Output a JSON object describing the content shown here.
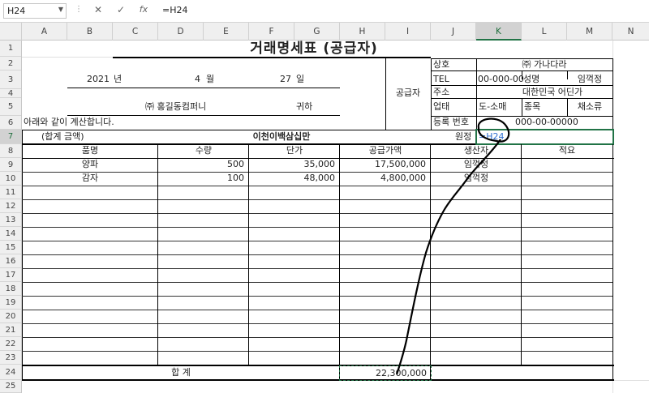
{
  "formula_bar": {
    "name_box": "H24",
    "cancel_icon": "cancel-icon",
    "enter_icon": "check-icon",
    "fx_label": "fx",
    "formula": "=H24"
  },
  "columns": [
    "A",
    "B",
    "C",
    "D",
    "E",
    "F",
    "G",
    "H",
    "I",
    "J",
    "K",
    "L",
    "M",
    "N"
  ],
  "selected_column": "K",
  "rows": [
    "1",
    "2",
    "3",
    "4",
    "5",
    "6",
    "7",
    "8",
    "9",
    "10",
    "11",
    "12",
    "13",
    "14",
    "15",
    "16",
    "17",
    "18",
    "19",
    "20",
    "21",
    "22",
    "23",
    "24",
    "25"
  ],
  "selected_row": "7",
  "invoice": {
    "title": "거래명세표 (공급자)",
    "year": "2021",
    "year_unit": "년",
    "month": "4",
    "month_unit": "월",
    "day": "27",
    "day_unit": "일",
    "recipient": "㈜ 홍길동컴퍼니",
    "honorific": "귀하",
    "statement": "아래와 같이 계산합니다.",
    "total_label": "(합계 금액)",
    "total_words": "이천이백삼십만",
    "won_label": "원정",
    "won_formula": "=H24",
    "supplier_label": "공급자",
    "supplier": {
      "company_label": "상호",
      "company": "㈜ 가나다라",
      "tel_label": "TEL",
      "tel": "00-000-00",
      "name_label": "성명",
      "name": "임꺽정",
      "address_label": "주소",
      "address": "대한민국 어딘가",
      "business_label": "업태",
      "business": "도-소매",
      "category_label": "종목",
      "category": "채소류",
      "reg_label": "등록 번호",
      "reg": "000-00-00000"
    },
    "table_headers": [
      "품명",
      "수량",
      "단가",
      "공급가액",
      "생산자",
      "적요"
    ],
    "items": [
      {
        "name": "양파",
        "qty": "500",
        "price": "35,000",
        "amount": "17,500,000",
        "producer": "임꺽정"
      },
      {
        "name": "감자",
        "qty": "100",
        "price": "48,000",
        "amount": "4,800,000",
        "producer": "임꺽정"
      }
    ],
    "sum_label": "합 계",
    "sum_value": "22,300,000"
  }
}
